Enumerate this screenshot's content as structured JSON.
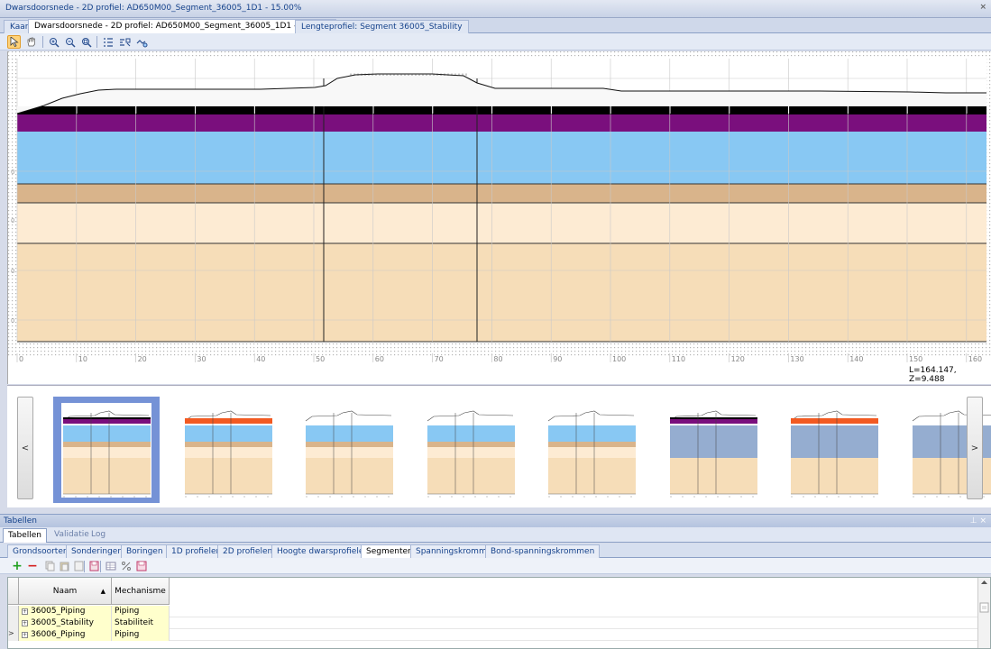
{
  "window": {
    "title": "Dwarsdoorsnede - 2D profiel: AD650M00_Segment_36005_1D1 - 15.00%",
    "close_glyph": "×"
  },
  "doc_tabs": [
    {
      "label": "Kaart",
      "active": false
    },
    {
      "label": "Dwarsdoorsnede - 2D profiel: AD650M00_Segment_36005_1D1 - 15.00%",
      "active": true
    },
    {
      "label": "Lengteprofiel: Segment 36005_Stability",
      "active": false
    }
  ],
  "toolbar": {
    "icons": [
      "select-arrow-icon",
      "pan-hand-icon",
      "zoom-in-icon",
      "zoom-out-icon",
      "zoom-extent-icon",
      "legend-list-icon",
      "layers-icon",
      "profile-tool-icon"
    ]
  },
  "profile_view": {
    "axis_ticks": [
      "0",
      "10",
      "20",
      "30",
      "40",
      "50",
      "60",
      "70",
      "80",
      "90",
      "100",
      "110",
      "120",
      "130",
      "140",
      "150",
      "160"
    ],
    "left_tick_labels": [
      "0",
      "0",
      "0",
      "0"
    ],
    "status": "L=164.147, Z=9.488",
    "layer_colors": {
      "black": "#000000",
      "purple": "#7a0f7d",
      "light_blue": "#88c8f3",
      "brown": "#d9b48b",
      "light_cream": "#fdebd3",
      "tan": "#f6ddb8"
    }
  },
  "thumbnails": {
    "prev_label": "<",
    "next_label": ">",
    "items": [
      {
        "top_layer": "#7a0f7d",
        "mid_layer": "#88c8f3",
        "selected": true
      },
      {
        "top_layer": "#f25a22",
        "mid_layer": "#88c8f3",
        "selected": false
      },
      {
        "top_layer": "none",
        "mid_layer": "#88c8f3",
        "selected": false
      },
      {
        "top_layer": "none",
        "mid_layer": "#88c8f3",
        "selected": false
      },
      {
        "top_layer": "none",
        "mid_layer": "#88c8f3",
        "selected": false
      },
      {
        "top_layer": "#7a0f7d",
        "mid_layer": "#95add0",
        "selected": false
      },
      {
        "top_layer": "#f25a22",
        "mid_layer": "#95add0",
        "selected": false
      },
      {
        "top_layer": "none",
        "mid_layer": "#95add0",
        "selected": false
      }
    ]
  },
  "tables_panel": {
    "title": "Tabellen",
    "pin_glyph": "⊥ ×",
    "tabs": [
      {
        "label": "Tabellen",
        "active": true
      },
      {
        "label": "Validatie",
        "active": false
      },
      {
        "label": "Log",
        "active": false
      }
    ],
    "sub_tabs": [
      {
        "label": "Grondsoorten",
        "active": false
      },
      {
        "label": "Sonderingen",
        "active": false
      },
      {
        "label": "Boringen",
        "active": false
      },
      {
        "label": "1D profielen",
        "active": false
      },
      {
        "label": "2D profielen",
        "active": false
      },
      {
        "label": "Hoogte dwarsprofielen",
        "active": false
      },
      {
        "label": "Segmenten",
        "active": true
      },
      {
        "label": "Spanningskrommen",
        "active": false
      },
      {
        "label": "Bond-spanningskrommen",
        "active": false
      }
    ],
    "grid_toolbar": {
      "add": "+",
      "remove": "−"
    },
    "columns": [
      {
        "label": "Naam",
        "sort": "▲"
      },
      {
        "label": "Mechanisme"
      }
    ],
    "rows": [
      {
        "naam": "36005_Piping",
        "mechanisme": "Piping",
        "current": false
      },
      {
        "naam": "36005_Stability",
        "mechanisme": "Stabiliteit",
        "current": false
      },
      {
        "naam": "36006_Piping",
        "mechanisme": "Piping",
        "current": true
      }
    ]
  }
}
